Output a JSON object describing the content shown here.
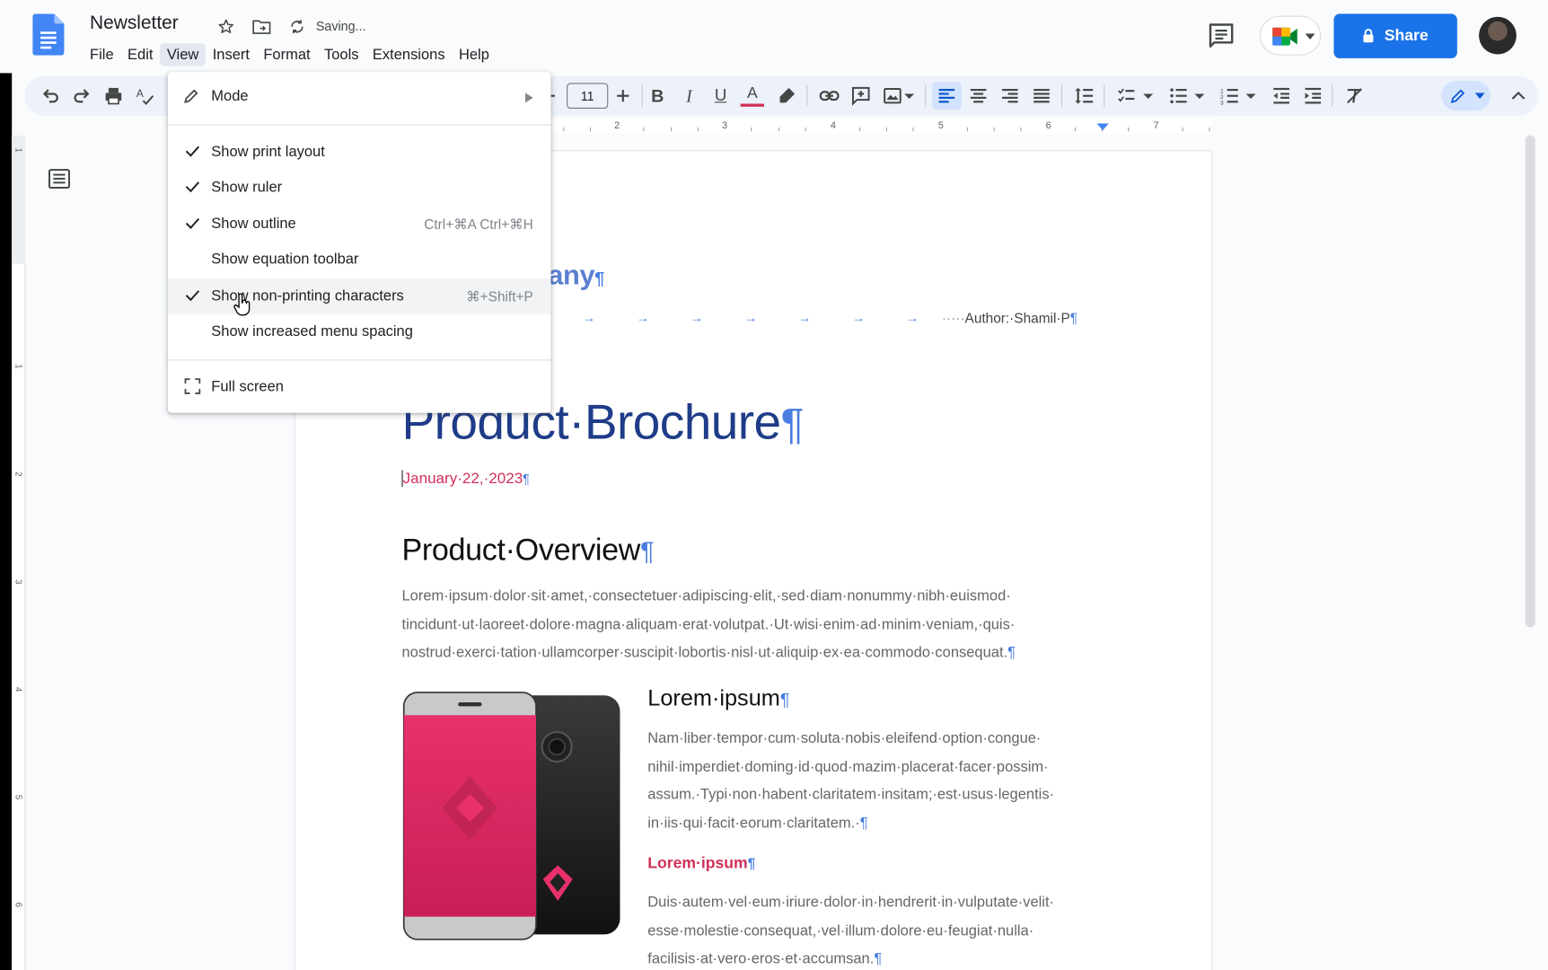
{
  "app": {
    "doc_title": "Newsletter",
    "saving_status": "Saving...",
    "share_label": "Share"
  },
  "menubar": {
    "items": [
      "File",
      "Edit",
      "View",
      "Insert",
      "Format",
      "Tools",
      "Extensions",
      "Help"
    ],
    "active": "View"
  },
  "toolbar": {
    "font_size": "11"
  },
  "ruler": {
    "ticks": [
      "2",
      "3",
      "4",
      "5",
      "6",
      "7"
    ],
    "vertical_ticks": [
      "1",
      "1",
      "2",
      "3",
      "4",
      "5",
      "6"
    ]
  },
  "view_menu": {
    "mode_label": "Mode",
    "items": [
      {
        "label": "Show print layout",
        "checked": true,
        "shortcut": ""
      },
      {
        "label": "Show ruler",
        "checked": true,
        "shortcut": ""
      },
      {
        "label": "Show outline",
        "checked": true,
        "shortcut": "Ctrl+⌘A Ctrl+⌘H"
      },
      {
        "label": "Show equation toolbar",
        "checked": false,
        "shortcut": ""
      },
      {
        "label": "Show non-printing characters",
        "checked": true,
        "shortcut": "⌘+Shift+P"
      },
      {
        "label": "Show increased menu spacing",
        "checked": false,
        "shortcut": ""
      }
    ],
    "full_screen_label": "Full screen"
  },
  "document": {
    "company_fragment": "any",
    "author": "Author:·Shamil·P",
    "title": "Product·Brochure",
    "date": "January·22,·2023",
    "overview_heading": "Product·Overview",
    "overview_lines": [
      "Lorem·ipsum·dolor·sit·amet,·consectetuer·adipiscing·elit,·sed·diam·nonummy·nibh·euismod·",
      "tincidunt·ut·laoreet·dolore·magna·aliquam·erat·volutpat.·Ut·wisi·enim·ad·minim·veniam,·quis·",
      "nostrud·exerci·tation·ullamcorper·suscipit·lobortis·nisl·ut·aliquip·ex·ea·commodo·consequat."
    ],
    "section_heading": "Lorem·ipsum",
    "section_lines": [
      "Nam·liber·tempor·cum·soluta·nobis·eleifend·option·congue·",
      "nihil·imperdiet·doming·id·quod·mazim·placerat·facer·possim·",
      "assum.·Typi·non·habent·claritatem·insitam;·est·usus·legentis·",
      "in·iis·qui·facit·eorum·claritatem.·"
    ],
    "subsection_heading": "Lorem·ipsum",
    "subsection_lines": [
      "Duis·autem·vel·eum·iriure·dolor·in·hendrerit·in·vulputate·velit·",
      "esse·molestie·consequat,·vel·illum·dolore·eu·feugiat·nulla·",
      "facilisis·at·vero·eros·et·accumsan."
    ]
  },
  "colors": {
    "accent_blue": "#1a73e8",
    "title_blue": "#1f3c88",
    "accent_pink": "#d0305a"
  }
}
